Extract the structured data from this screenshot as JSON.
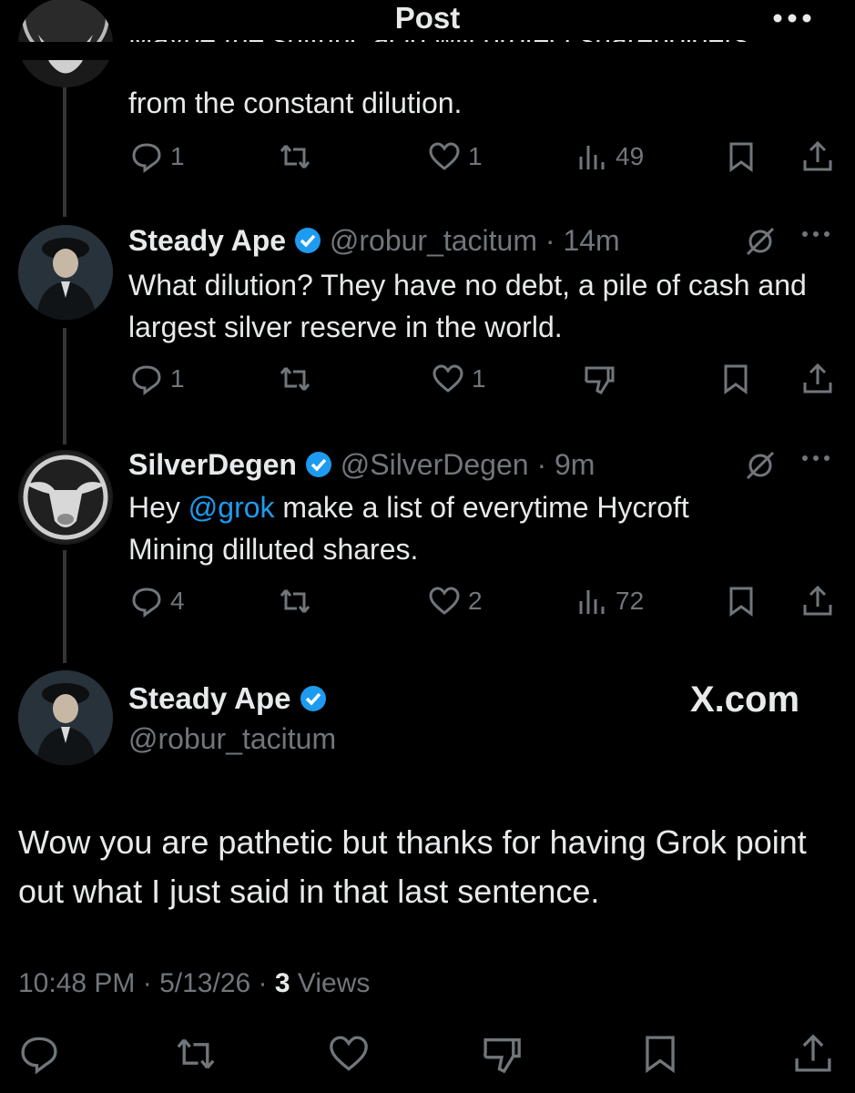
{
  "header": {
    "title": "Post"
  },
  "thread_top": {
    "text_partial": "Maybe the sulfuric acid will protect shareholders",
    "text_line2": "from the constant dilution.",
    "replies": "1",
    "likes": "1",
    "views": "49"
  },
  "reply1": {
    "name": "Steady Ape",
    "handle": "@robur_tacitum",
    "time": "14m",
    "text": "What dilution?  They have no debt, a pile of cash and largest silver reserve in the world.",
    "replies": "1",
    "likes": "1"
  },
  "reply2": {
    "name": "SilverDegen",
    "handle": "@SilverDegen",
    "time": "9m",
    "text_before": "Hey ",
    "mention": "@grok",
    "text_after": " make a list of everytime Hycroft Mining dilluted shares.",
    "replies": "4",
    "likes": "2",
    "views": "72"
  },
  "main_post": {
    "name": "Steady Ape",
    "handle": "@robur_tacitum",
    "watermark": "X.com",
    "text": "Wow you are pathetic but thanks for having Grok point out what I just said in that last sentence.",
    "time": "10:48 PM",
    "date": "5/13/26",
    "views_count": "3",
    "views_label": "Views"
  },
  "colors": {
    "accent": "#1d9bf0",
    "muted": "#71767b",
    "verified": "#1d9bf0"
  }
}
